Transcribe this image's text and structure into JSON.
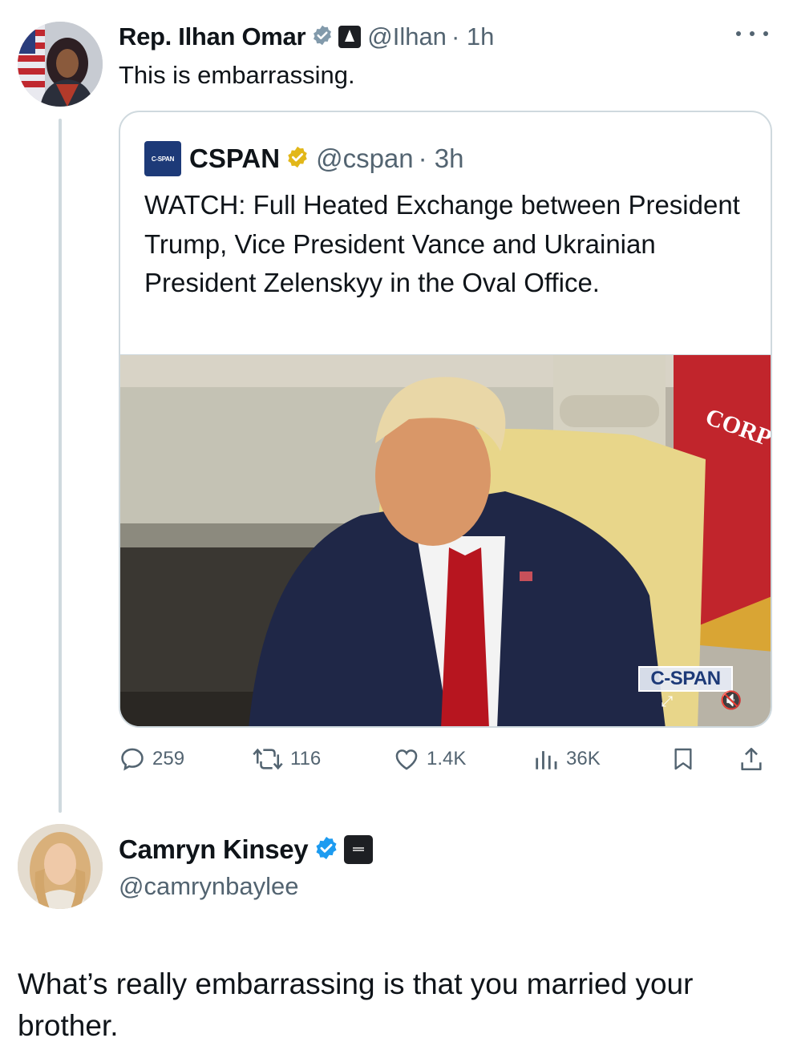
{
  "omar_tweet": {
    "avatar": "ilhan-omar-photo",
    "name": "Rep. Ilhan Omar",
    "verified_badge": "gray-check-icon",
    "affiliation_badge": "capitol-icon",
    "handle": "@Ilhan",
    "time": "· 1h",
    "more_icon": "ellipsis-icon",
    "text": "This is embarrassing."
  },
  "quoted_tweet": {
    "logo_text": "C-SPAN",
    "name": "CSPAN",
    "verified_badge": "gold-check-icon",
    "handle": "@cspan",
    "time": "· 3h",
    "text": "WATCH: Full Heated Exchange between President Trump, Vice President Vance and Ukrainian President Zelenskyy in the Oval Office.",
    "video": {
      "watermark": "C-SPAN",
      "flag_text": "CORP",
      "expand_icon": "expand-arrows-icon",
      "mute_icon": "speaker-muted-icon"
    }
  },
  "actions": {
    "replies": "259",
    "reposts": "116",
    "likes": "1.4K",
    "views": "36K",
    "icons": [
      "reply-icon",
      "repost-icon",
      "heart-icon",
      "views-icon",
      "bookmark-icon",
      "share-icon"
    ]
  },
  "reply": {
    "avatar": "camryn-kinsey-photo",
    "name": "Camryn Kinsey",
    "verified_badge": "blue-check-icon",
    "affiliation_badge": "affiliate-logo-icon",
    "handle": "@camrynbaylee",
    "text": "What’s really embarrassing is that you married your brother."
  },
  "colors": {
    "text": "#0f1419",
    "secondary": "#536471",
    "border": "#cfd9de",
    "blue_check": "#1d9bf0",
    "gold_check": "#e2b719",
    "gray_check": "#829aab"
  }
}
